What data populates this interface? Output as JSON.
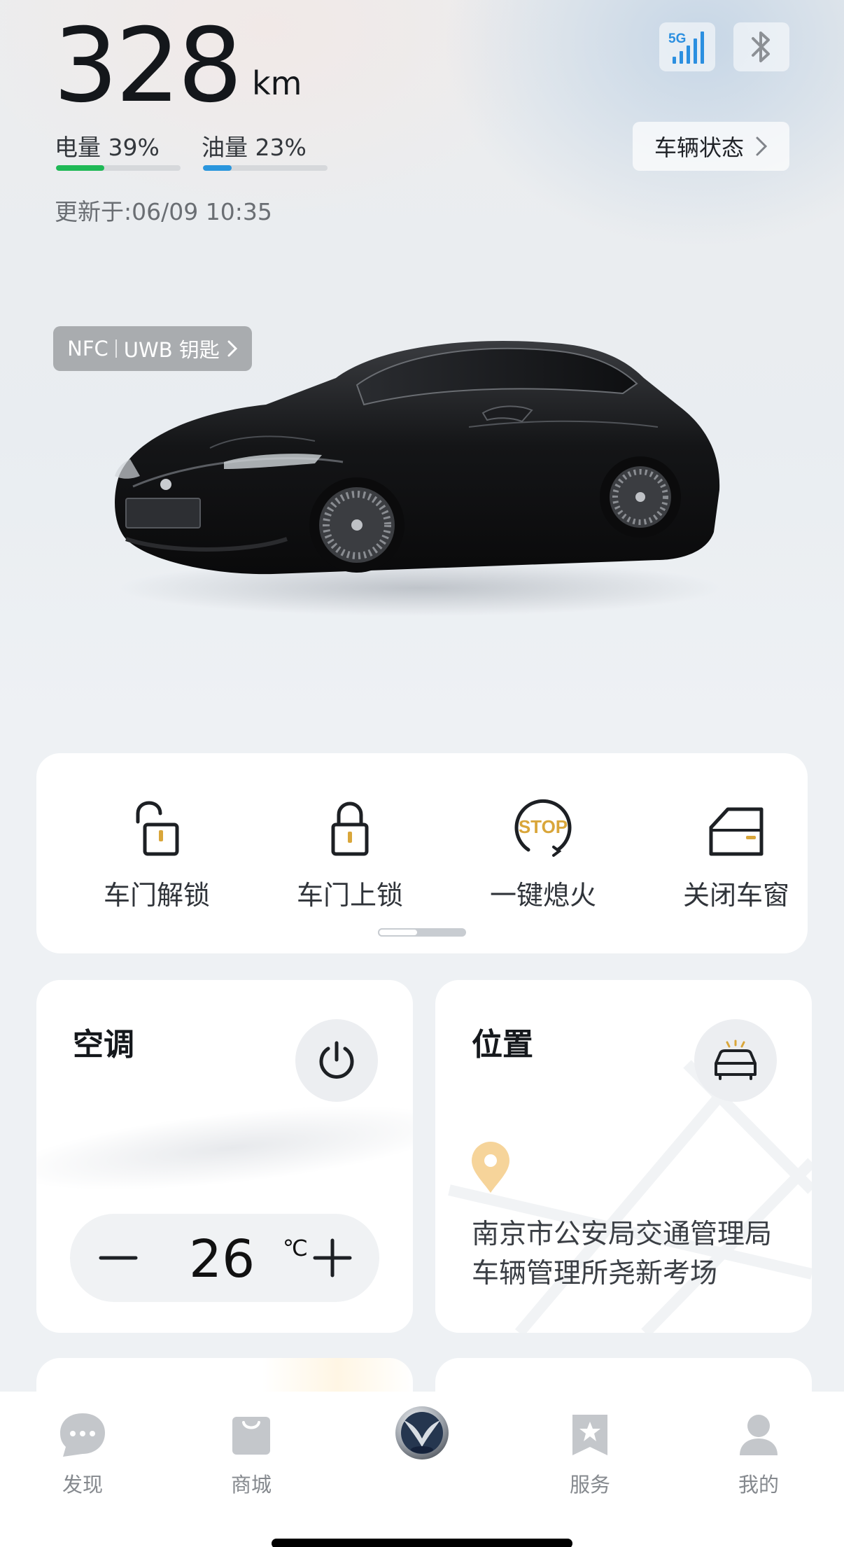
{
  "vehicle": {
    "range_value": "328",
    "range_unit": "km",
    "battery_label": "电量 39%",
    "battery_level": 0.39,
    "fuel_label": "油量 23%",
    "fuel_level": 0.23,
    "updated": "更新于:06/09 10:35",
    "network_badge": "5G",
    "status_button": "车辆状态",
    "nfc_label": "NFC",
    "uwb_label": "UWB 钥匙"
  },
  "colors": {
    "battery_bar": "#1fb956",
    "fuel_bar": "#2a96dd",
    "network_icon": "#2b8fe0",
    "accent_gold": "#d9a63a",
    "pin": "#f6d49a"
  },
  "quick_actions": [
    {
      "label": "车门解锁",
      "icon": "unlock-icon"
    },
    {
      "label": "车门上锁",
      "icon": "lock-icon"
    },
    {
      "label": "一键熄火",
      "icon": "stop-engine-icon",
      "icon_text": "STOP"
    },
    {
      "label": "关闭车窗",
      "icon": "window-icon"
    }
  ],
  "climate": {
    "title": "空调",
    "temperature": "26",
    "unit": "℃"
  },
  "location": {
    "title": "位置",
    "address": "南京市公安局交通管理局车辆管理所尧新考场"
  },
  "tabs": [
    {
      "label": "发现",
      "icon": "chat-bubble-icon"
    },
    {
      "label": "商城",
      "icon": "shopping-bag-icon"
    },
    {
      "label": "",
      "icon": "brand-logo-icon"
    },
    {
      "label": "服务",
      "icon": "star-bookmark-icon"
    },
    {
      "label": "我的",
      "icon": "person-icon"
    }
  ]
}
